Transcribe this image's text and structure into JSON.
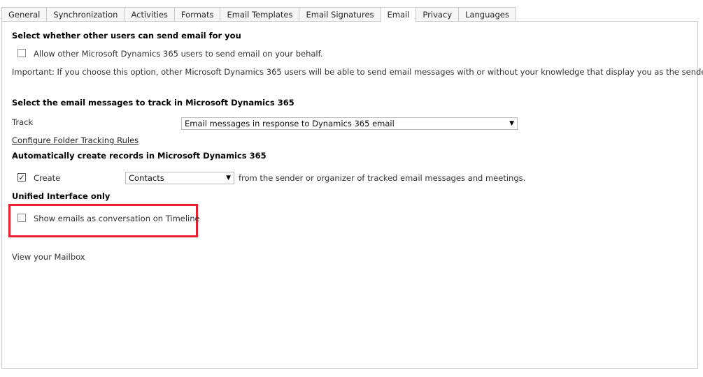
{
  "tabs": [
    {
      "label": "General",
      "active": false
    },
    {
      "label": "Synchronization",
      "active": false
    },
    {
      "label": "Activities",
      "active": false
    },
    {
      "label": "Formats",
      "active": false
    },
    {
      "label": "Email Templates",
      "active": false
    },
    {
      "label": "Email Signatures",
      "active": false
    },
    {
      "label": "Email",
      "active": true
    },
    {
      "label": "Privacy",
      "active": false
    },
    {
      "label": "Languages",
      "active": false
    }
  ],
  "send_on_behalf": {
    "heading": "Select whether other users can send email for you",
    "checkbox_label": "Allow other Microsoft Dynamics 365 users to send email on your behalf.",
    "checked": false,
    "note": "Important: If you choose this option, other Microsoft Dynamics 365 users will be able to send email messages with or without your knowledge that display you as the sender."
  },
  "tracking": {
    "heading": "Select the email messages to track in Microsoft Dynamics 365",
    "track_label": "Track",
    "track_value": "Email messages in response to Dynamics 365 email",
    "folder_link": "Configure Folder Tracking Rules"
  },
  "auto_create": {
    "heading": "Automatically create records in Microsoft Dynamics 365",
    "create_label": "Create",
    "checked": true,
    "record_type": "Contacts",
    "suffix": "from the sender or organizer of tracked email messages and meetings."
  },
  "unified": {
    "heading": "Unified Interface only",
    "checkbox_label": "Show emails as conversation on Timeline",
    "checked": false
  },
  "mailbox_link": "View your Mailbox",
  "colors": {
    "highlight": "#e8202e",
    "border": "#c8c8c8"
  }
}
